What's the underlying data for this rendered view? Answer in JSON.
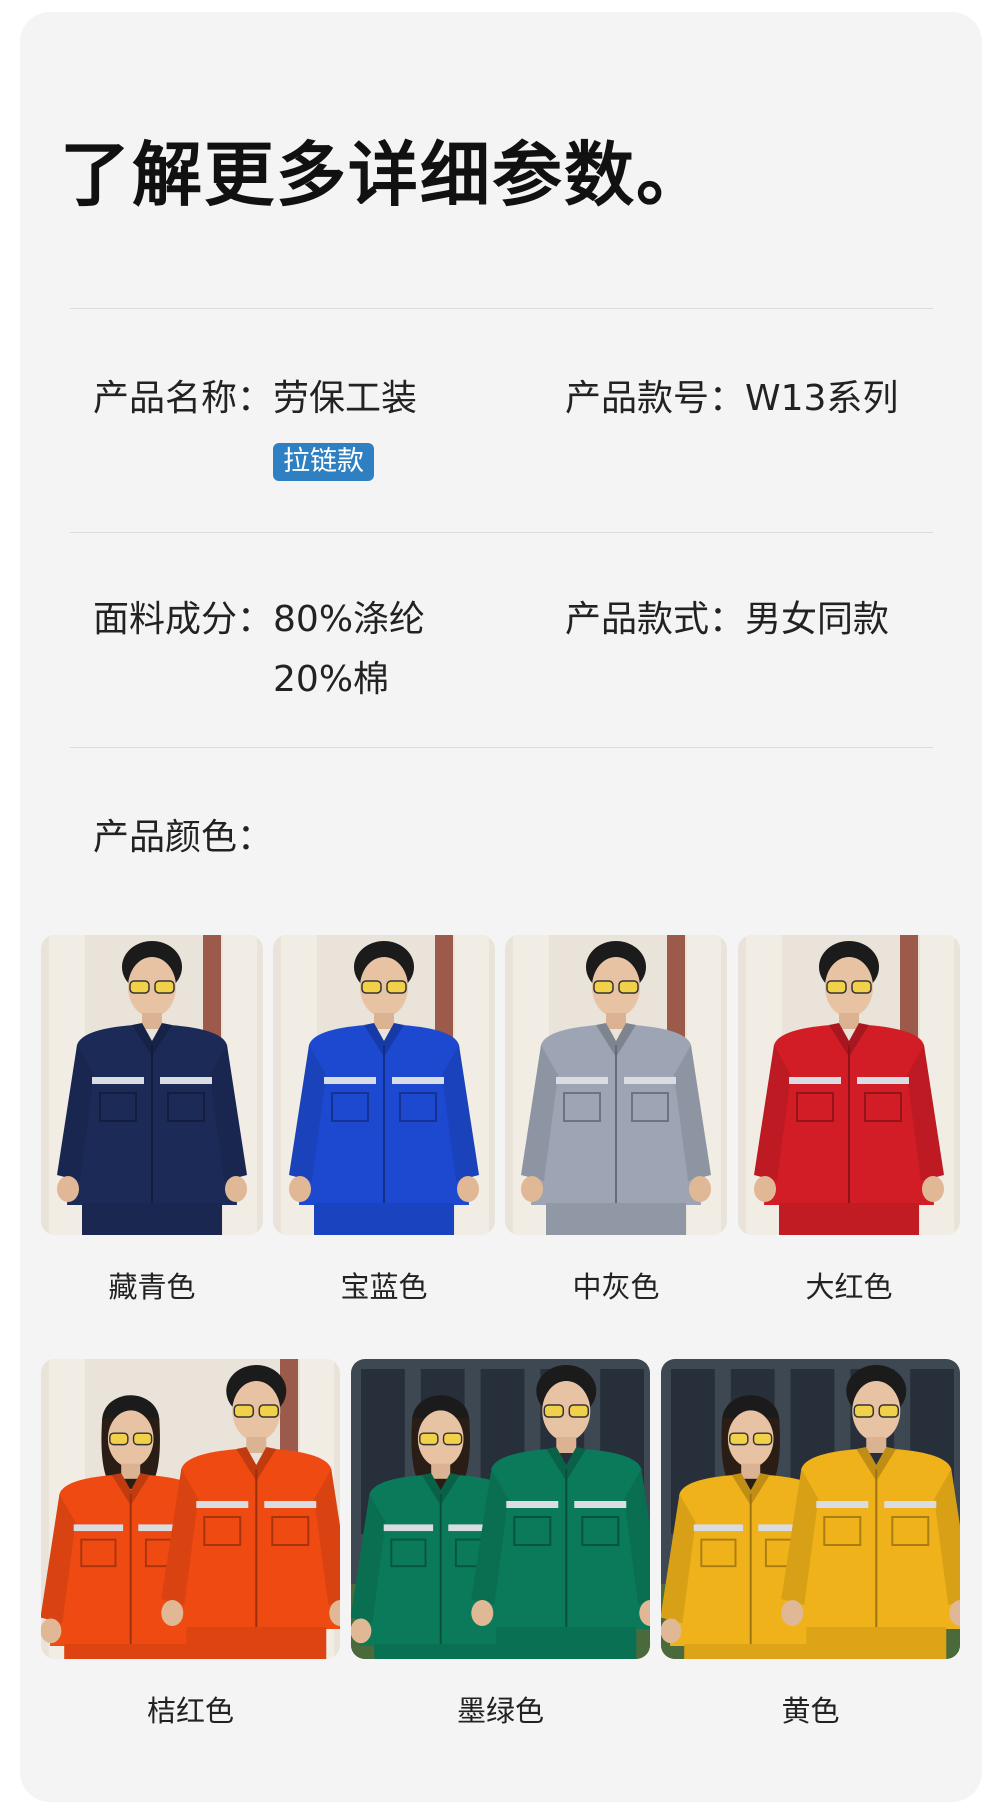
{
  "title": "了解更多详细参数。",
  "specs": {
    "name": {
      "label": "产品名称：",
      "value": "劳保工装",
      "tag": "拉链款"
    },
    "model": {
      "label": "产品款号：",
      "value": "W13系列"
    },
    "fabric": {
      "label": "面料成分：",
      "lines": [
        "80%涤纶",
        "20%棉"
      ]
    },
    "style": {
      "label": "产品款式：",
      "value": "男女同款"
    },
    "color": {
      "label": "产品颜色："
    }
  },
  "swatches": [
    {
      "name": "藏青色",
      "color": "#1c2a58"
    },
    {
      "name": "宝蓝色",
      "color": "#1c49d0"
    },
    {
      "name": "中灰色",
      "color": "#9da5b4"
    },
    {
      "name": "大红色",
      "color": "#d21d27"
    },
    {
      "name": "桔红色",
      "color": "#f04a13"
    },
    {
      "name": "墨绿色",
      "color": "#0b7a5a"
    },
    {
      "name": "黄色",
      "color": "#f0b21a"
    }
  ],
  "colors": {
    "tag_bg": "#2f80c3",
    "card_bg": "#f4f4f4"
  }
}
